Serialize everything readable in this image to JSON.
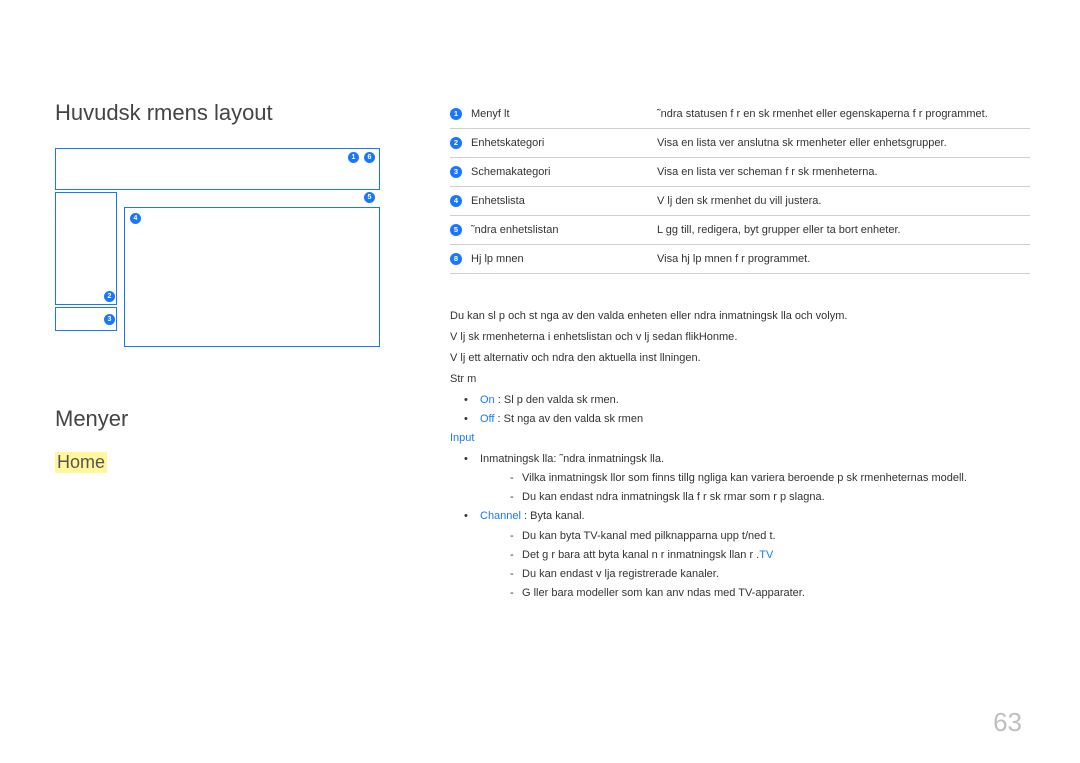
{
  "pageNumber": "63",
  "headings": {
    "layout": "Huvudsk rmens layout",
    "menus": "Menyer",
    "home": "Home"
  },
  "legend": [
    {
      "num": "1",
      "label": "Menyf lt",
      "desc": "˜ndra statusen f r en sk rmenhet eller egenskaperna f r programmet."
    },
    {
      "num": "2",
      "label": "Enhetskategori",
      "desc": "Visa en lista  ver anslutna sk rmenheter eller enhetsgrupper."
    },
    {
      "num": "3",
      "label": "Schemakategori",
      "desc": "Visa en lista  ver scheman f r sk rmenheterna."
    },
    {
      "num": "4",
      "label": "Enhetslista",
      "desc": "V lj den sk rmenhet du vill justera."
    },
    {
      "num": "5",
      "label": "˜ndra enhetslistan",
      "desc": "L gg till, redigera, byt grupper eller ta bort enheter."
    },
    {
      "num": "8",
      "label": "Hj lp mnen",
      "desc": "Visa hj lp mnen f r programmet."
    }
  ],
  "body": {
    "p1": "Du kan sl  p  och st nga av den valda enheten eller  ndra inmatningsk lla och volym.",
    "p2_pre": "V lj sk rmenheterna i enhetslistan och v lj sedan flikHonme",
    "p2_post": ".",
    "p3": "V lj ett alternativ och  ndra den aktuella inst llningen.",
    "power_label": "Str m",
    "on_label": "On",
    "on_text": " : Sl  p  den valda sk rmen.",
    "off_label": "Off",
    "off_text": " : St nga av den valda sk rmen",
    "input_label": "Input",
    "inm_text": "Inmatningsk lla: ˜ndra inmatningsk lla.",
    "inm_d1": "Vilka inmatningsk llor som finns tillg ngliga kan variera beroende p  sk rmenheternas modell.",
    "inm_d2": "Du kan endast  ndra inmatningsk lla f r sk rmar som  r p slagna.",
    "channel_label": "Channel",
    "channel_text": " : Byta kanal.",
    "ch_d1": "Du kan byta TV-kanal med pilknapparna upp t/ned t.",
    "ch_d2_pre": "Det g r bara att byta kanal n r inmatningsk llan  r .",
    "ch_d2_tv": "TV",
    "ch_d3": "Du kan endast v lja registrerade kanaler.",
    "ch_d4": "G ller bara modeller som kan anv ndas med TV-apparater."
  },
  "dcirc": {
    "n1": "1",
    "n2": "2",
    "n3": "3",
    "n4": "4",
    "n5": "5",
    "n6": "6"
  }
}
